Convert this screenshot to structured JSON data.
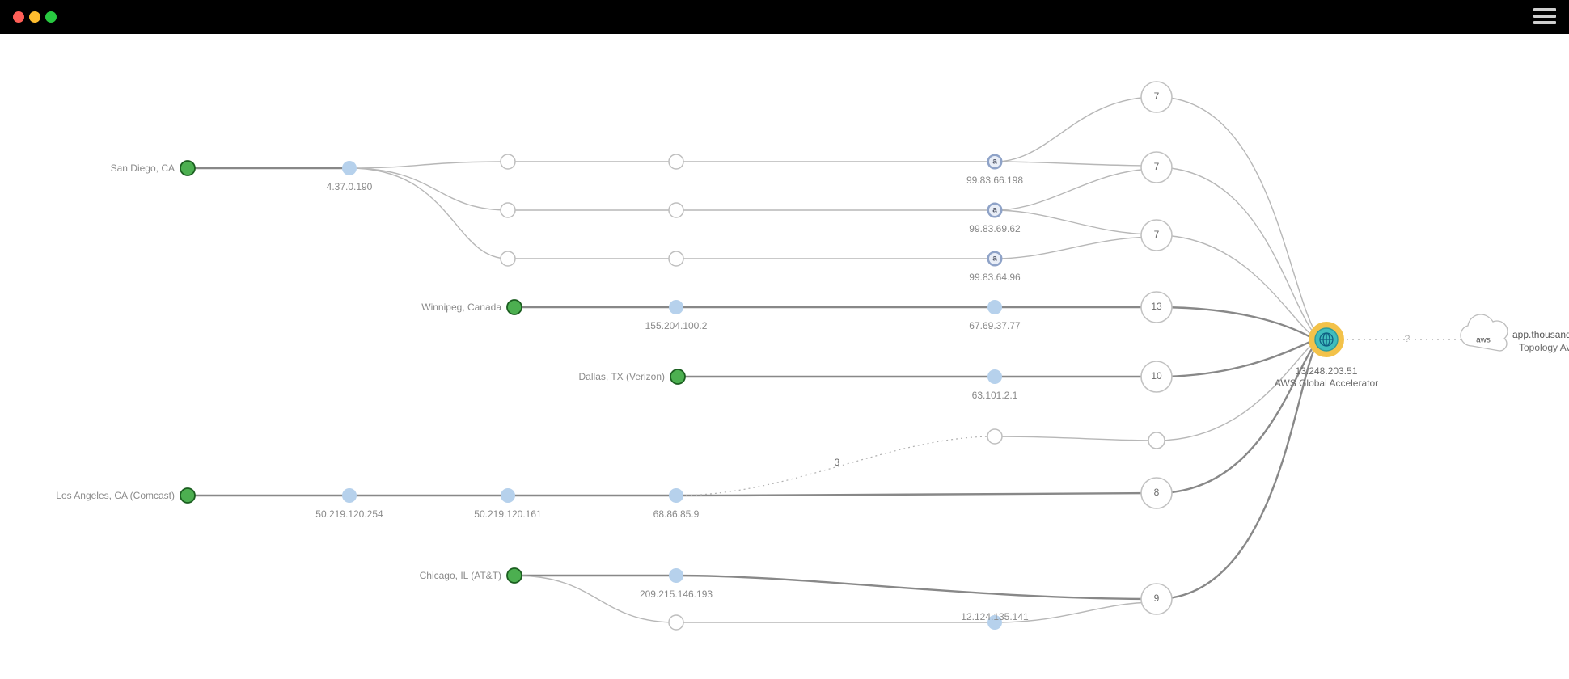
{
  "sources": {
    "san_diego": {
      "label": "San Diego, CA"
    },
    "winnipeg": {
      "label": "Winnipeg, Canada"
    },
    "dallas": {
      "label": "Dallas, TX (Verizon)"
    },
    "losangeles": {
      "label": "Los Angeles, CA (Comcast)"
    },
    "chicago": {
      "label": "Chicago, IL (AT&T)"
    }
  },
  "hops": {
    "sd_hop1": "4.37.0.190",
    "a1": "99.83.66.198",
    "a2": "99.83.69.62",
    "a3": "99.83.64.96",
    "wpg_hop2": "155.204.100.2",
    "wpg_hop3": "67.69.37.77",
    "dal_hop1": "63.101.2.1",
    "la_hop1": "50.219.120.254",
    "la_hop2": "50.219.120.161",
    "la_hop3": "68.86.85.9",
    "chi_hop1": "209.215.146.193",
    "chi_hop2": "12.124.135.141",
    "la_dash_count": "3"
  },
  "hubs": {
    "h1": "7",
    "h2": "7",
    "h3": "7",
    "h4": "13",
    "h5": "10",
    "h6": "8",
    "h7": "9"
  },
  "destination": {
    "ip": "13.248.203.51",
    "name": "AWS Global Accelerator"
  },
  "endpoint": {
    "title": "app.thousandeyes.com",
    "sub": "Topology Available",
    "cloud_label": "aws"
  },
  "q_mark": "?"
}
